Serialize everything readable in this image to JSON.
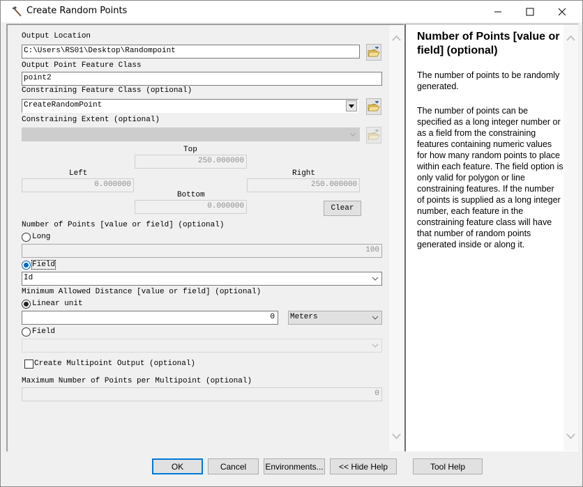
{
  "window": {
    "title": "Create Random Points",
    "icon": "hammer-icon",
    "controls": [
      "minimize",
      "maximize",
      "close"
    ]
  },
  "form": {
    "output_location": {
      "label": "Output Location",
      "value": "C:\\Users\\RS01\\Desktop\\Randompoint"
    },
    "output_point_feature_class": {
      "label": "Output Point Feature Class",
      "value": "point2"
    },
    "constraining_feature_class": {
      "label": "Constraining Feature Class (optional)",
      "value": "CreateRandomPoint"
    },
    "constraining_extent": {
      "label": "Constraining Extent (optional)",
      "value": "",
      "top_label": "Top",
      "top_value": "250.000000",
      "left_label": "Left",
      "left_value": "0.000000",
      "right_label": "Right",
      "right_value": "250.000000",
      "bottom_label": "Bottom",
      "bottom_value": "0.000000",
      "clear_label": "Clear"
    },
    "number_of_points": {
      "label": "Number of Points [value or field] (optional)",
      "long_label": "Long",
      "long_selected": false,
      "long_value": "100",
      "field_label": "Field",
      "field_selected": true,
      "field_value": "Id"
    },
    "minimum_distance": {
      "label": "Minimum Allowed Distance [value or field] (optional)",
      "linear_label": "Linear unit",
      "linear_selected": true,
      "linear_value": "0",
      "unit_value": "Meters",
      "field_label": "Field",
      "field_selected": false,
      "field_value": ""
    },
    "multipoint": {
      "label": "Create Multipoint Output (optional)",
      "checked": false
    },
    "max_points_per_multipoint": {
      "label": "Maximum Number of Points per Multipoint (optional)",
      "value": "0"
    }
  },
  "help": {
    "title": "Number of Points [value or field] (optional)",
    "paragraphs": [
      "The number of points to be randomly generated.",
      "The number of points can be specified as a long integer number or as a field from the constraining features containing numeric values for how many random points to place within each feature. The field option is only valid for polygon or line constraining features. If the number of points is supplied as a long integer number, each feature in the constraining feature class will have that number of random points generated inside or along it."
    ]
  },
  "buttons": {
    "ok": "OK",
    "cancel": "Cancel",
    "environments": "Environments...",
    "hide_help": "<< Hide Help",
    "tool_help": "Tool Help"
  }
}
